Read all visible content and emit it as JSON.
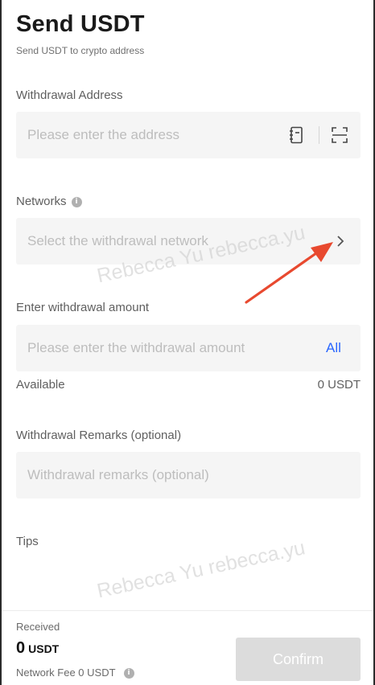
{
  "header": {
    "title": "Send USDT",
    "subtitle": "Send USDT to crypto address"
  },
  "address": {
    "label": "Withdrawal Address",
    "placeholder": "Please enter the address",
    "icons": [
      "address-book-icon",
      "scan-icon"
    ]
  },
  "network": {
    "label": "Networks",
    "info_icon": "i",
    "placeholder": "Select the withdrawal network",
    "chevron": "chevron-right-icon"
  },
  "amount": {
    "label": "Enter withdrawal amount",
    "placeholder": "Please enter the withdrawal amount",
    "all_label": "All",
    "available_label": "Available",
    "available_value": "0 USDT"
  },
  "remarks": {
    "label": "Withdrawal Remarks (optional)",
    "placeholder": "Withdrawal remarks (optional)"
  },
  "tips": {
    "label": "Tips"
  },
  "watermarks": [
    "Rebecca Yu rebecca.yu",
    "Rebecca Yu rebecca.yu"
  ],
  "footer": {
    "received_label": "Received",
    "received_amount": "0",
    "received_unit": "USDT",
    "network_fee": "Network Fee 0 USDT",
    "fee_info_icon": "i",
    "confirm_label": "Confirm"
  },
  "colors": {
    "accent": "#2a67ff",
    "annotation_arrow": "#e8492f",
    "field_bg": "#f5f5f5",
    "disabled_button": "#dcdcdc"
  }
}
